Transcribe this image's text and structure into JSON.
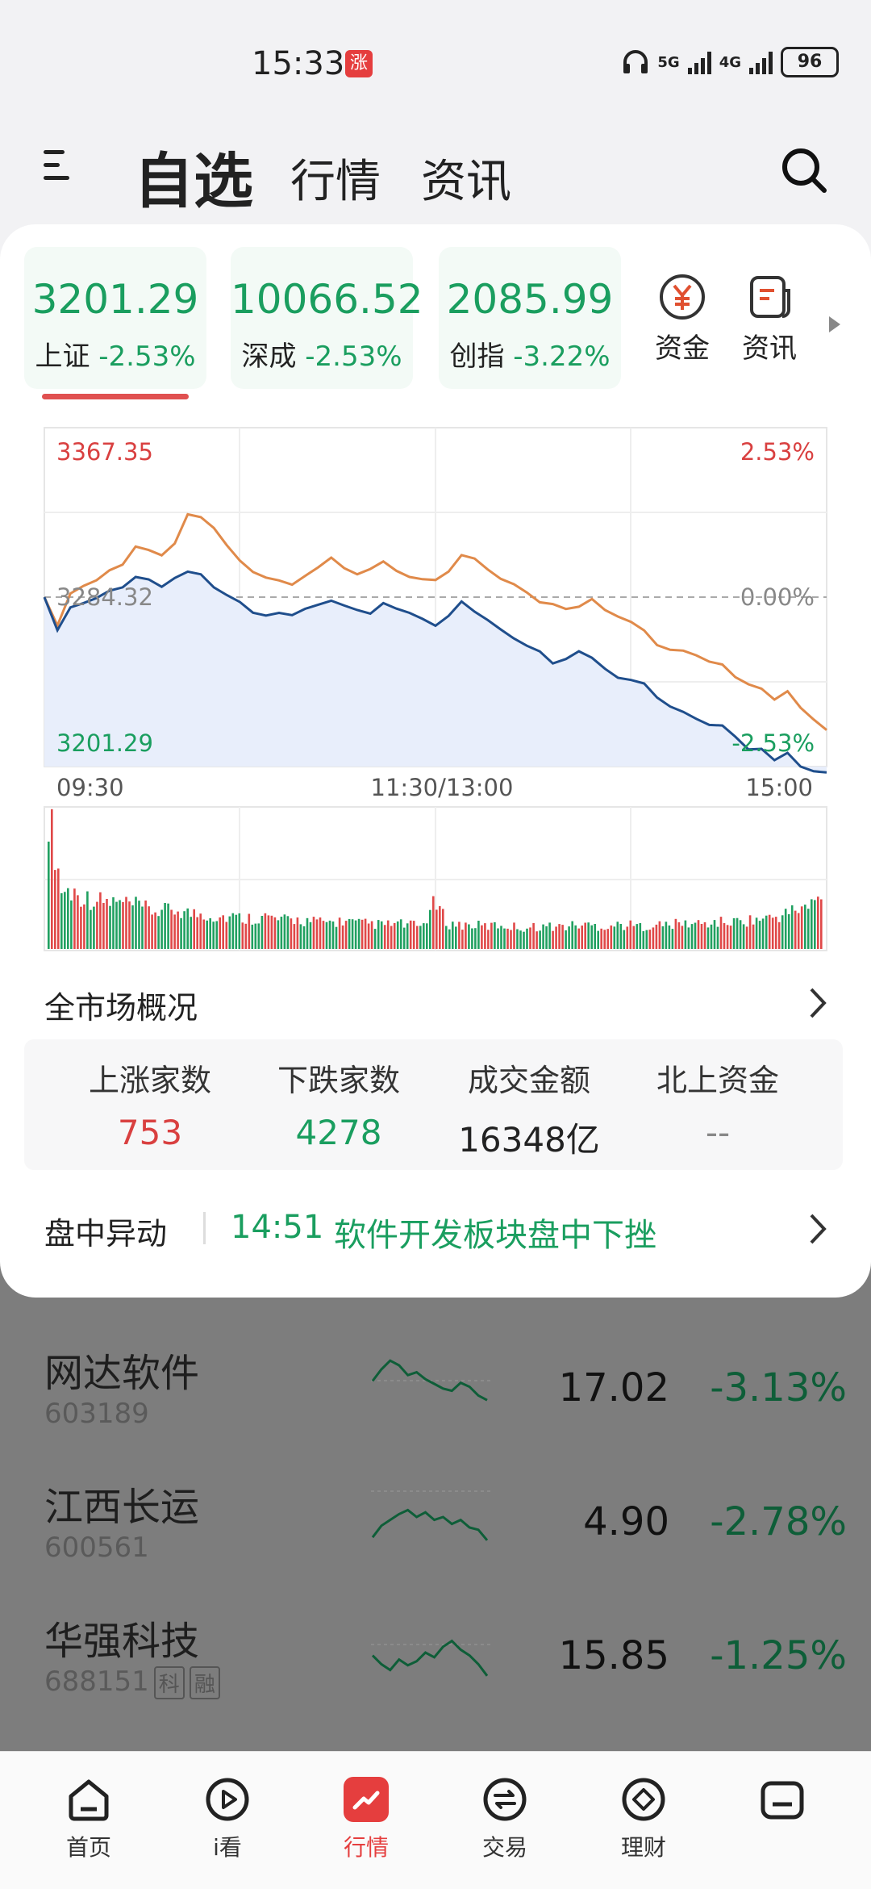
{
  "status_bar": {
    "time": "15:33",
    "badge": "涨",
    "net1": "5G",
    "net2": "4G",
    "battery": "96"
  },
  "nav": {
    "tabs": [
      "自选",
      "行情",
      "资讯"
    ]
  },
  "indices": [
    {
      "value": "3201.29",
      "name": "上证",
      "change": "-2.53%"
    },
    {
      "value": "10066.52",
      "name": "深成",
      "change": "-2.53%"
    },
    {
      "value": "2085.99",
      "name": "创指",
      "change": "-3.22%"
    }
  ],
  "tools": [
    {
      "label": "资金",
      "icon": "yuan-coin-icon"
    },
    {
      "label": "资讯",
      "icon": "news-doc-icon"
    }
  ],
  "chart_data": {
    "type": "line",
    "title": "",
    "series": [
      {
        "values": [
          3284.3,
          3270.4,
          3286.1,
          3289.8,
          3292.6,
          3297.5,
          3300.2,
          3309.1,
          3307.4,
          3304.8,
          3310.6,
          3324.9,
          3323.5,
          3318.2,
          3309.7,
          3302.2,
          3296.6,
          3293.9,
          3292.5,
          3290.4,
          3294.7,
          3298.9,
          3303.7,
          3298.5,
          3295.5,
          3298.1,
          3301.8,
          3297.2,
          3294.2,
          3293.1,
          3292.7,
          3296.8,
          3304.9,
          3303.2,
          3297.9,
          3293.3,
          3290.7,
          3286.6,
          3281.8,
          3280.9,
          3278.5,
          3279.6,
          3283.4,
          3278.0,
          3274.8,
          3272.2,
          3268.0,
          3260.8,
          3258.5,
          3258.1,
          3255.8,
          3252.7,
          3251.3,
          3245.1,
          3241.6,
          3239.5,
          3234.1,
          3238.2,
          3230.1,
          3224.4,
          3219.2
        ]
      },
      {
        "values": [
          3284.3,
          3268.1,
          3279.3,
          3281.4,
          3283.9,
          3287.5,
          3289.1,
          3294.2,
          3293.0,
          3289.4,
          3293.7,
          3296.8,
          3295.5,
          3289.1,
          3285.3,
          3281.9,
          3276.7,
          3275.3,
          3276.6,
          3275.5,
          3278.6,
          3280.6,
          3282.6,
          3280.2,
          3278.0,
          3276.2,
          3281.4,
          3278.7,
          3276.6,
          3273.7,
          3270.3,
          3275.1,
          3282.2,
          3277.2,
          3273.1,
          3268.5,
          3264.1,
          3260.5,
          3257.7,
          3251.8,
          3254.0,
          3257.8,
          3254.6,
          3249.2,
          3244.8,
          3243.7,
          3242.0,
          3235.1,
          3230.7,
          3228.1,
          3224.7,
          3221.7,
          3221.4,
          3215.9,
          3209.7,
          3210.0,
          3204.4,
          3208.0,
          3201.3,
          3199.0,
          3198.4
        ]
      }
    ],
    "volume": [
      0.98,
      0.42,
      0.4,
      0.36,
      0.34,
      0.33,
      0.32,
      0.3,
      0.27,
      0.27,
      0.28,
      0.25,
      0.25,
      0.23,
      0.23,
      0.22,
      0.22,
      0.23,
      0.2,
      0.21,
      0.2,
      0.19,
      0.19,
      0.2,
      0.18,
      0.18,
      0.17,
      0.18,
      0.17,
      0.16,
      0.33,
      0.18,
      0.17,
      0.17,
      0.16,
      0.17,
      0.16,
      0.15,
      0.16,
      0.16,
      0.16,
      0.17,
      0.17,
      0.16,
      0.17,
      0.17,
      0.16,
      0.17,
      0.17,
      0.18,
      0.18,
      0.18,
      0.19,
      0.19,
      0.2,
      0.21,
      0.22,
      0.24,
      0.28,
      0.3,
      0.37
    ],
    "left_labels": {
      "top": "3367.35",
      "mid": "3284.32",
      "bottom": "3201.29"
    },
    "right_labels": {
      "top": "2.53%",
      "mid": "0.00%",
      "bottom": "-2.53%"
    },
    "x_labels": [
      "09:30",
      "11:30/13:00",
      "15:00"
    ],
    "ylim": [
      3201.29,
      3367.35
    ],
    "grid": true,
    "colors": {
      "index_line": "#1f4e8c",
      "reference_line": "#e08a4a",
      "area": "#e8eefb",
      "up": "#e04848",
      "down": "#20a060"
    }
  },
  "overview": {
    "title": "全市场概况",
    "stats": [
      {
        "label": "上涨家数",
        "value": "753",
        "color": "#d94040"
      },
      {
        "label": "下跌家数",
        "value": "4278",
        "color": "#1a9e5f"
      },
      {
        "label": "成交金额",
        "value": "16348亿",
        "color": "#222222"
      },
      {
        "label": "北上资金",
        "value": "--",
        "color": "#888888"
      }
    ]
  },
  "event": {
    "label": "盘中异动",
    "time": "14:51",
    "text": "软件开发板块盘中下挫"
  },
  "stocks": [
    {
      "name": "网达软件",
      "code": "603189",
      "price": "17.02",
      "change": "-3.13%",
      "tags": [],
      "spark": [
        0.45,
        0.25,
        0.1,
        0.18,
        0.35,
        0.3,
        0.42,
        0.5,
        0.58,
        0.62,
        0.48,
        0.55,
        0.7,
        0.78
      ]
    },
    {
      "name": "江西长运",
      "code": "600561",
      "price": "4.90",
      "change": "-2.78%",
      "tags": [],
      "spark": [
        0.85,
        0.65,
        0.55,
        0.45,
        0.38,
        0.5,
        0.42,
        0.55,
        0.5,
        0.62,
        0.55,
        0.68,
        0.72,
        0.9
      ]
    },
    {
      "name": "华强科技",
      "code": "688151",
      "price": "15.85",
      "change": "-1.25%",
      "tags": [
        "科",
        "融"
      ],
      "spark": [
        0.55,
        0.7,
        0.8,
        0.62,
        0.72,
        0.65,
        0.5,
        0.58,
        0.4,
        0.3,
        0.45,
        0.55,
        0.7,
        0.9
      ]
    }
  ],
  "bottom_nav": [
    {
      "label": "首页",
      "icon": "home-icon",
      "active": false
    },
    {
      "label": "i看",
      "icon": "play-icon",
      "active": false
    },
    {
      "label": "行情",
      "icon": "chart-trend-icon",
      "active": true
    },
    {
      "label": "交易",
      "icon": "exchange-icon",
      "active": false
    },
    {
      "label": "理财",
      "icon": "diamond-icon",
      "active": false
    },
    {
      "label": "",
      "icon": "wallet-icon",
      "active": false
    }
  ]
}
